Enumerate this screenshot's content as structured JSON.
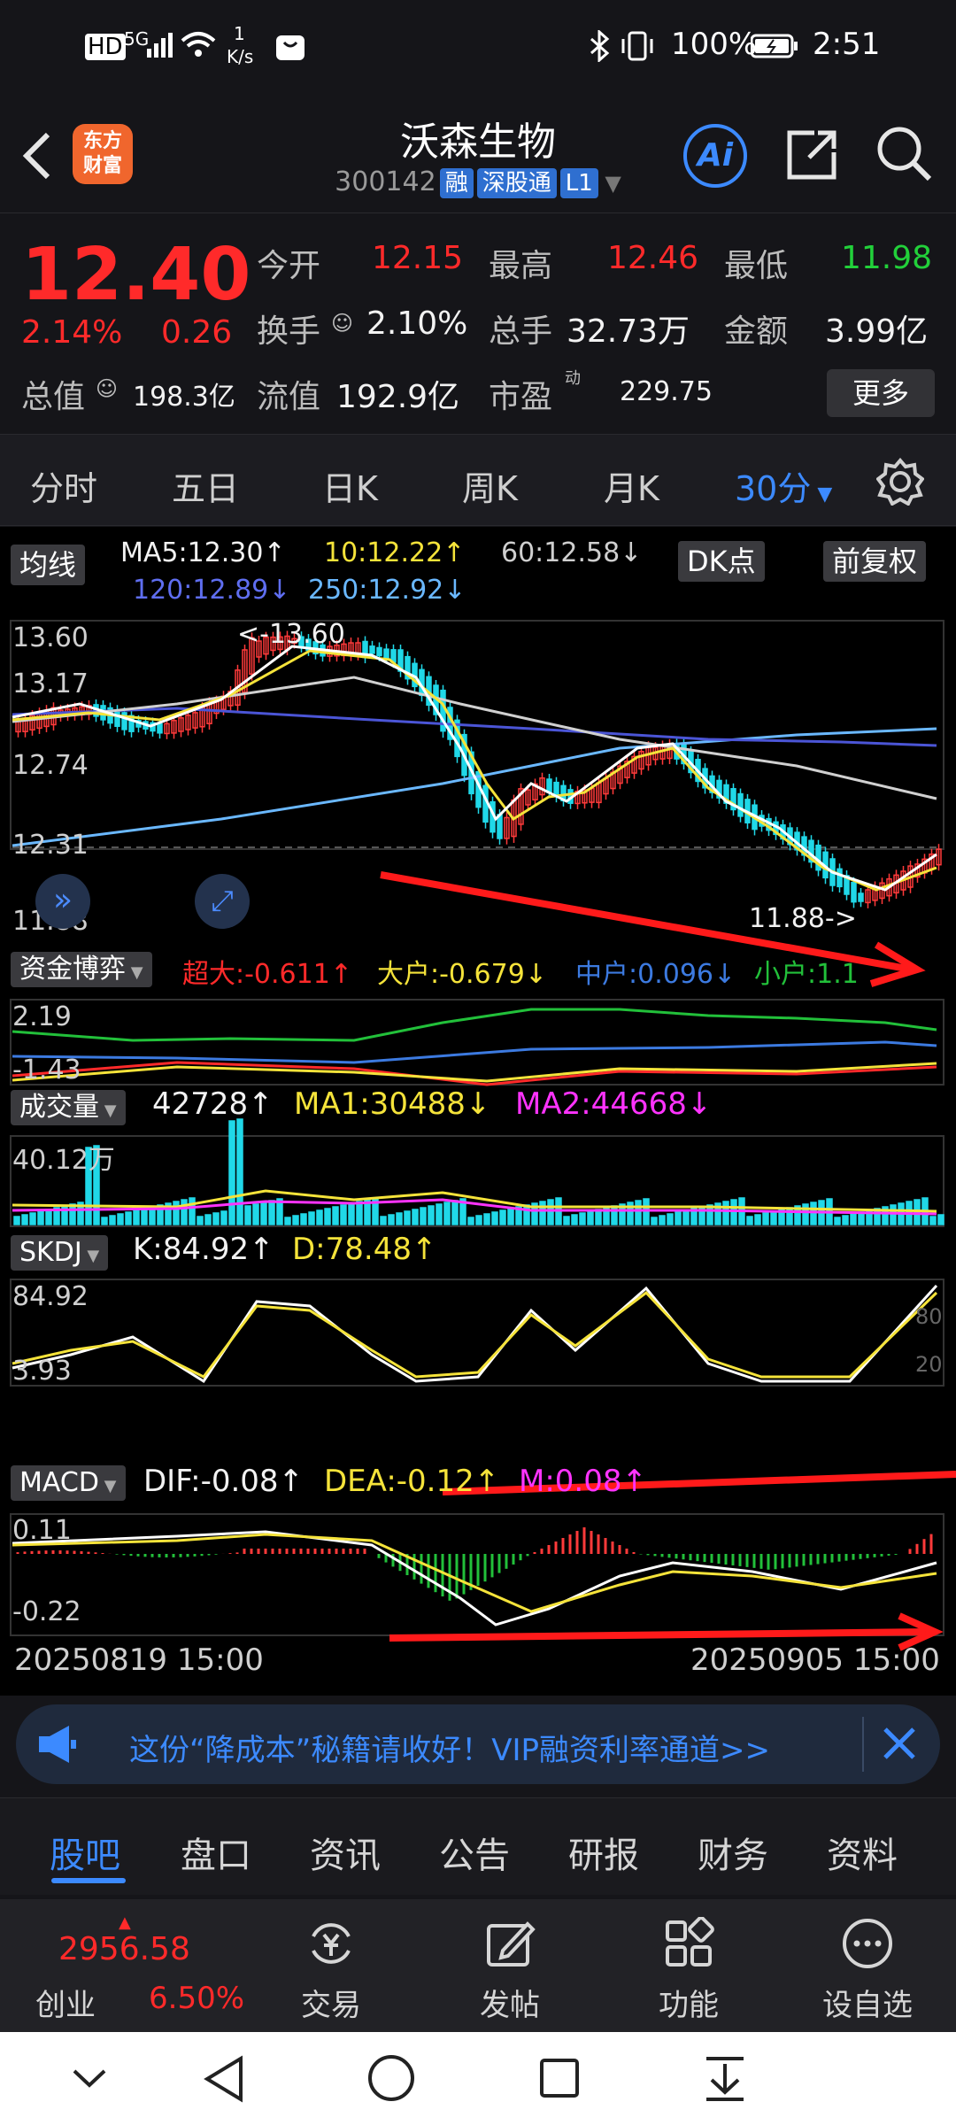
{
  "status": {
    "net": "5G",
    "speed_num": "1",
    "speed_unit": "K/s",
    "battery": "100%",
    "time": "2:51"
  },
  "header": {
    "logo_top": "东方",
    "logo_bottom": "财富",
    "stock_name": "沃森生物",
    "stock_code": "300142",
    "tags": [
      "融",
      "深股通",
      "L1"
    ],
    "ai_label": "Ai"
  },
  "quote": {
    "price": "12.40",
    "change_pct": "2.14%",
    "change_amt": "0.26",
    "open_label": "今开",
    "open": "12.15",
    "high_label": "最高",
    "high": "12.46",
    "low_label": "最低",
    "low": "11.98",
    "turnover_label": "换手",
    "turnover": "2.10%",
    "volume_label": "总手",
    "volume": "32.73万",
    "amount_label": "金额",
    "amount": "3.99亿",
    "mktcap_label": "总值",
    "mktcap": "198.3亿",
    "float_label": "流值",
    "float": "192.9亿",
    "pe_label": "市盈",
    "pe_mark": "动",
    "pe": "229.75",
    "more": "更多"
  },
  "period_tabs": [
    "分时",
    "五日",
    "日K",
    "周K",
    "月K",
    "30分"
  ],
  "chart": {
    "ma_label": "均线",
    "ma5": "MA5:12.30↑",
    "ma10": "10:12.22↑",
    "ma60": "60:12.58↓",
    "ma120": "120:12.89↓",
    "ma250": "250:12.92↓",
    "dk_btn": "DK点",
    "fq_btn": "前复权",
    "price_axis": [
      "13.60",
      "13.17",
      "12.74",
      "12.31",
      "11.88"
    ],
    "max_mark": "13.60",
    "min_mark": "11.88->",
    "fund_label": "资金博弈",
    "super": "超大:-0.611↑",
    "big": "大户:-0.679↓",
    "mid": "中户:0.096↓",
    "small": "小户:1.1",
    "fund_axis": [
      "2.19",
      "-1.43"
    ],
    "vol_label": "成交量",
    "vol_val": "42728↑",
    "vol_ma1": "MA1:30488↓",
    "vol_ma2": "MA2:44668↓",
    "vol_axis": "40.12万",
    "skdj_label": "SKDJ",
    "skdj_k": "K:84.92↑",
    "skdj_d": "D:78.48↑",
    "skdj_axis": [
      "84.92",
      "3.93"
    ],
    "skdj_ref": [
      "80",
      "20"
    ],
    "macd_label": "MACD",
    "dif": "DIF:-0.08↑",
    "dea": "DEA:-0.12↑",
    "m": "M:0.08↑",
    "macd_axis": [
      "0.11",
      "-0.22"
    ],
    "date_start": "20250819 15:00",
    "date_end": "20250905 15:00"
  },
  "banner": {
    "text": "这份“降成本”秘籍请收好！VIP融资利率通道>>"
  },
  "bottom_tabs": [
    "股吧",
    "盘口",
    "资讯",
    "公告",
    "研报",
    "财务",
    "资料"
  ],
  "toolbar": {
    "index_value": "2956.58",
    "index_name": "创业",
    "index_pct": "6.50%",
    "items": [
      "交易",
      "发帖",
      "功能",
      "设自选"
    ]
  }
}
